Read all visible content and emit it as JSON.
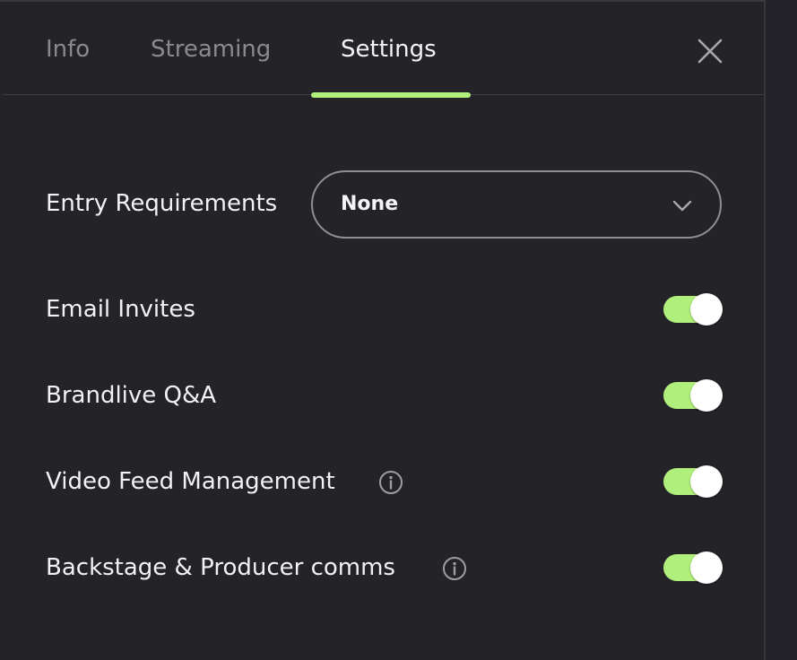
{
  "tabs": {
    "info": "Info",
    "streaming": "Streaming",
    "settings": "Settings",
    "active": "Settings"
  },
  "entry_requirements": {
    "label": "Entry Requirements",
    "value": "None"
  },
  "settings": {
    "email_invites": {
      "label": "Email Invites",
      "enabled": true
    },
    "brandlive_qa": {
      "label": "Brandlive Q&A",
      "enabled": true
    },
    "video_feed_management": {
      "label": "Video Feed Management",
      "enabled": true
    },
    "backstage_producer_comms": {
      "label": "Backstage & Producer comms",
      "enabled": true
    }
  },
  "icons": {
    "close": "close-icon",
    "chevron": "chevron-down-icon",
    "info": "info-icon"
  },
  "colors": {
    "accent": "#b1f07b",
    "background": "#242328",
    "text": "#f2f2f4",
    "muted_text": "#8b8a91"
  }
}
